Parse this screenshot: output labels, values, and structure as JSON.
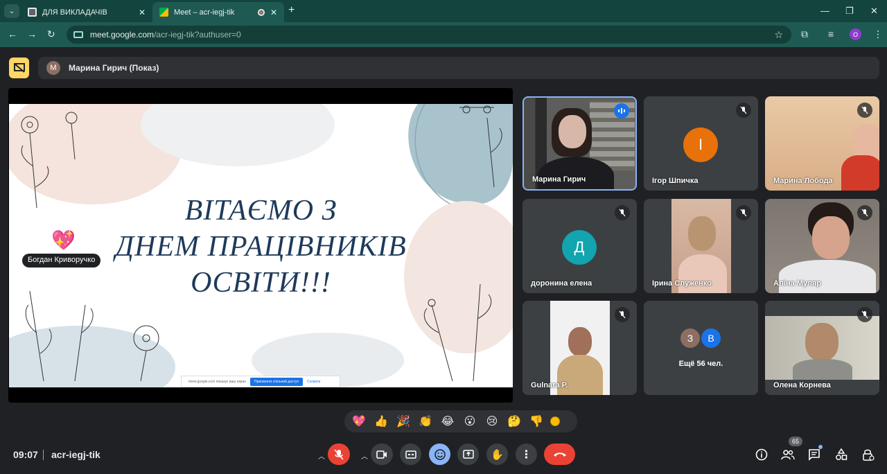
{
  "browser": {
    "tabs": [
      {
        "title": "ДЛЯ ВИКЛАДАЧІВ"
      },
      {
        "title": "Meet – acr-iegj-tik"
      }
    ],
    "url_host": "meet.google.com",
    "url_path": "/acr-iegj-tik?authuser=0",
    "profile_initial": "O"
  },
  "meet": {
    "presenter_initial": "M",
    "presenter_banner": "Марина Гирич (Показ)",
    "slide": {
      "line1": "ВІТАЄМО З",
      "line2": "ДНЕМ ПРАЦІВНИКІВ",
      "line3": "ОСВІТИ!!!"
    },
    "share_notice": {
      "text": "meet.google.com показує ваш екран",
      "stop_label": "Припинити спільний доступ",
      "hide_label": "Сховати"
    },
    "reaction_sender": "Богдан Криворучко",
    "participants": [
      {
        "name": "Марина Гирич"
      },
      {
        "name": "Ігор Шпичка",
        "initial": "І",
        "color": "#e8710a"
      },
      {
        "name": "Марина Лобода"
      },
      {
        "name": "доронина елена",
        "initial": "Д",
        "color": "#12a4af"
      },
      {
        "name": "Ірина Служенко"
      },
      {
        "name": "Аліна Муляр"
      },
      {
        "name": "Gulnara P."
      },
      {
        "more_initials": [
          "З",
          "В"
        ],
        "more_label": "Ещё 56 чел."
      },
      {
        "name": "Олена Корнева"
      }
    ],
    "reactions": [
      "💖",
      "👍",
      "🎉",
      "👏",
      "😂",
      "😮",
      "😢",
      "🤔",
      "👎"
    ],
    "time": "09:07",
    "meeting_code": "acr-iegj-tik",
    "people_count": "65"
  }
}
